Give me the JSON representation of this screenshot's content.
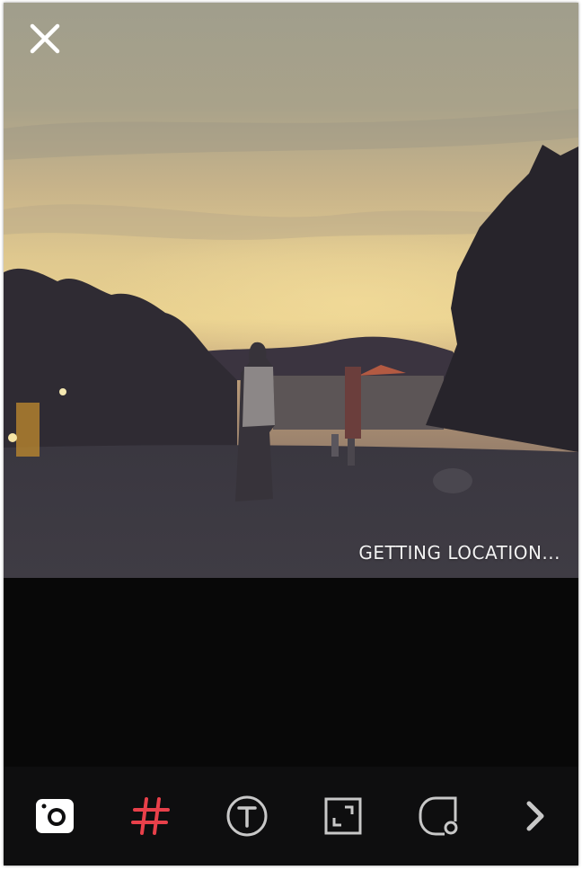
{
  "photo": {
    "location_status": "GETTING LOCATION..."
  },
  "toolbar": {
    "items": [
      {
        "icon": "camera-icon",
        "active": true
      },
      {
        "icon": "hashtag-icon",
        "color": "#e8404a"
      },
      {
        "icon": "text-icon"
      },
      {
        "icon": "crop-icon"
      },
      {
        "icon": "sticker-icon"
      },
      {
        "icon": "chevron-right-icon"
      }
    ]
  },
  "colors": {
    "accent": "#e8404a",
    "icon": "#c8c8c8",
    "background": "#0a0a0b"
  }
}
